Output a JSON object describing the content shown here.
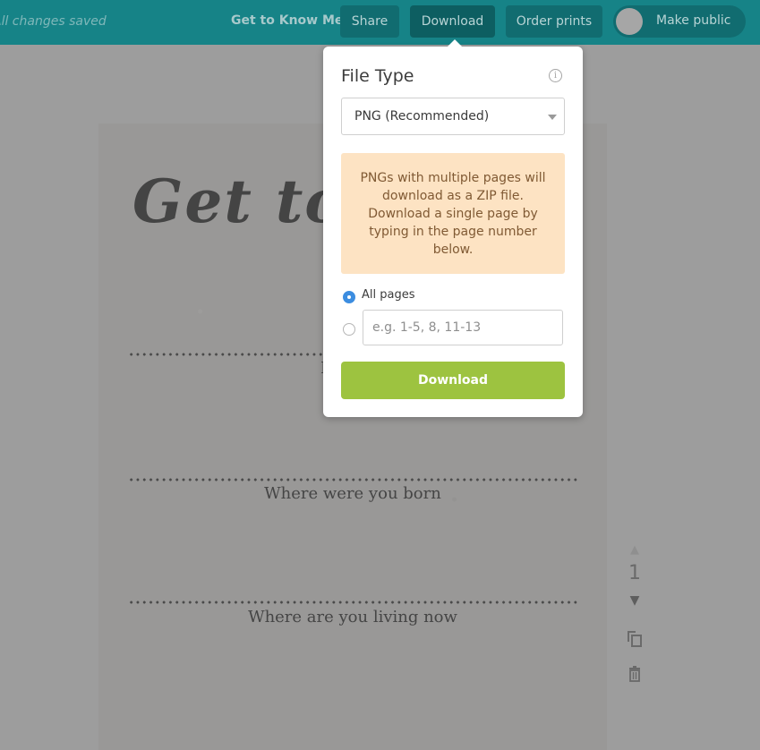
{
  "topbar": {
    "save_status": "All changes saved",
    "document_title": "Get to Know Me",
    "share_label": "Share",
    "download_label": "Download",
    "order_prints_label": "Order prints",
    "make_public_label": "Make public",
    "make_public_on": false,
    "colors": {
      "bar": "#168387",
      "button": "#116c70"
    }
  },
  "design": {
    "heading": "Get to",
    "questions": [
      "I",
      "Where were you born",
      "Where are you living now"
    ]
  },
  "page_controls": {
    "page_number": "1",
    "icons": [
      "page-up-icon",
      "page-down-icon",
      "duplicate-page-icon",
      "delete-page-icon"
    ]
  },
  "download_popover": {
    "title": "File Type",
    "info_icon": "info-icon",
    "file_type_selected": "PNG (Recommended)",
    "notice": "PNGs with multiple pages will download as a ZIP file. Download a single page by typing in the page number below.",
    "options": [
      {
        "label": "All pages",
        "checked": true
      },
      {
        "label": "",
        "checked": false
      }
    ],
    "pages_input_value": "",
    "pages_input_placeholder": "e.g. 1-5, 8, 11-13",
    "download_button": "Download",
    "colors": {
      "notice_bg": "#fde3c3",
      "download_bg": "#9dc340",
      "radio_checked": "#3c8de0"
    }
  }
}
